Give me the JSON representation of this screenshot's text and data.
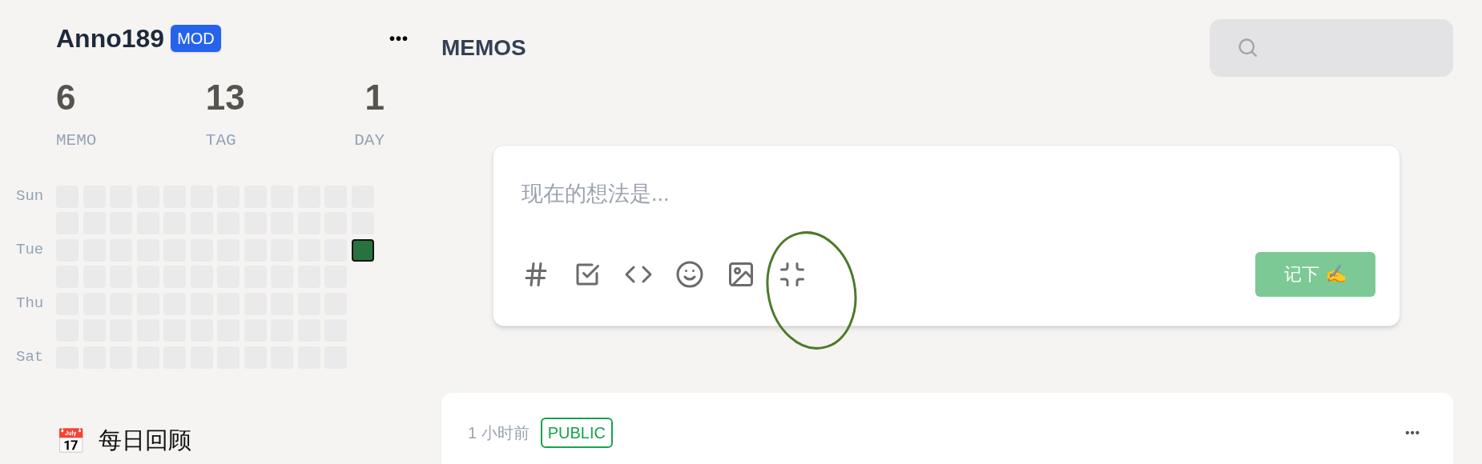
{
  "user": {
    "name": "Anno189",
    "role_badge": "MOD",
    "menu_icon": "•••"
  },
  "stats": [
    {
      "value": "6",
      "label": "MEMO"
    },
    {
      "value": "13",
      "label": "TAG"
    },
    {
      "value": "1",
      "label": "DAY"
    }
  ],
  "heatmap": {
    "day_labels": [
      "Sun",
      "Tue",
      "Thu",
      "Sat"
    ],
    "weeks": [
      {
        "days": [
          {
            "active": false
          },
          {
            "active": false
          },
          {
            "active": false
          },
          {
            "active": false
          },
          {
            "active": false
          },
          {
            "active": false
          },
          {
            "active": false
          }
        ]
      },
      {
        "days": [
          {
            "active": false
          },
          {
            "active": false
          },
          {
            "active": false
          },
          {
            "active": false
          },
          {
            "active": false
          },
          {
            "active": false
          },
          {
            "active": false
          }
        ]
      },
      {
        "days": [
          {
            "active": false
          },
          {
            "active": false
          },
          {
            "active": false
          },
          {
            "active": false
          },
          {
            "active": false
          },
          {
            "active": false
          },
          {
            "active": false
          }
        ]
      },
      {
        "days": [
          {
            "active": false
          },
          {
            "active": false
          },
          {
            "active": false
          },
          {
            "active": false
          },
          {
            "active": false
          },
          {
            "active": false
          },
          {
            "active": false
          }
        ]
      },
      {
        "days": [
          {
            "active": false
          },
          {
            "active": false
          },
          {
            "active": false
          },
          {
            "active": false
          },
          {
            "active": false
          },
          {
            "active": false
          },
          {
            "active": false
          }
        ]
      },
      {
        "days": [
          {
            "active": false
          },
          {
            "active": false
          },
          {
            "active": false
          },
          {
            "active": false
          },
          {
            "active": false
          },
          {
            "active": false
          },
          {
            "active": false
          }
        ]
      },
      {
        "days": [
          {
            "active": false
          },
          {
            "active": false
          },
          {
            "active": false
          },
          {
            "active": false
          },
          {
            "active": false
          },
          {
            "active": false
          },
          {
            "active": false
          }
        ]
      },
      {
        "days": [
          {
            "active": false
          },
          {
            "active": false
          },
          {
            "active": false
          },
          {
            "active": false
          },
          {
            "active": false
          },
          {
            "active": false
          },
          {
            "active": false
          }
        ]
      },
      {
        "days": [
          {
            "active": false
          },
          {
            "active": false
          },
          {
            "active": false
          },
          {
            "active": false
          },
          {
            "active": false
          },
          {
            "active": false
          },
          {
            "active": false
          }
        ]
      },
      {
        "days": [
          {
            "active": false
          },
          {
            "active": false
          },
          {
            "active": false
          },
          {
            "active": false
          },
          {
            "active": false
          },
          {
            "active": false
          },
          {
            "active": false
          }
        ]
      },
      {
        "days": [
          {
            "active": false
          },
          {
            "active": false
          },
          {
            "active": false
          },
          {
            "active": false
          },
          {
            "active": false
          },
          {
            "active": false
          },
          {
            "active": false
          }
        ]
      },
      {
        "days": [
          {
            "active": false
          },
          {
            "active": false
          },
          {
            "active": true
          }
        ]
      }
    ]
  },
  "sidebar_items": [
    {
      "emoji": "📅",
      "label": "每日回顾"
    }
  ],
  "page_title": "MEMOS",
  "editor": {
    "placeholder": "现在的想法是...",
    "toolbar": [
      {
        "kind": "tag"
      },
      {
        "kind": "todo"
      },
      {
        "kind": "code"
      },
      {
        "kind": "emoji"
      },
      {
        "kind": "image"
      },
      {
        "kind": "collapse"
      }
    ],
    "submit": "记下 ✍️"
  },
  "memos": [
    {
      "time": "1 小时前",
      "visibility": "PUBLIC",
      "menu_icon": "•••"
    }
  ]
}
